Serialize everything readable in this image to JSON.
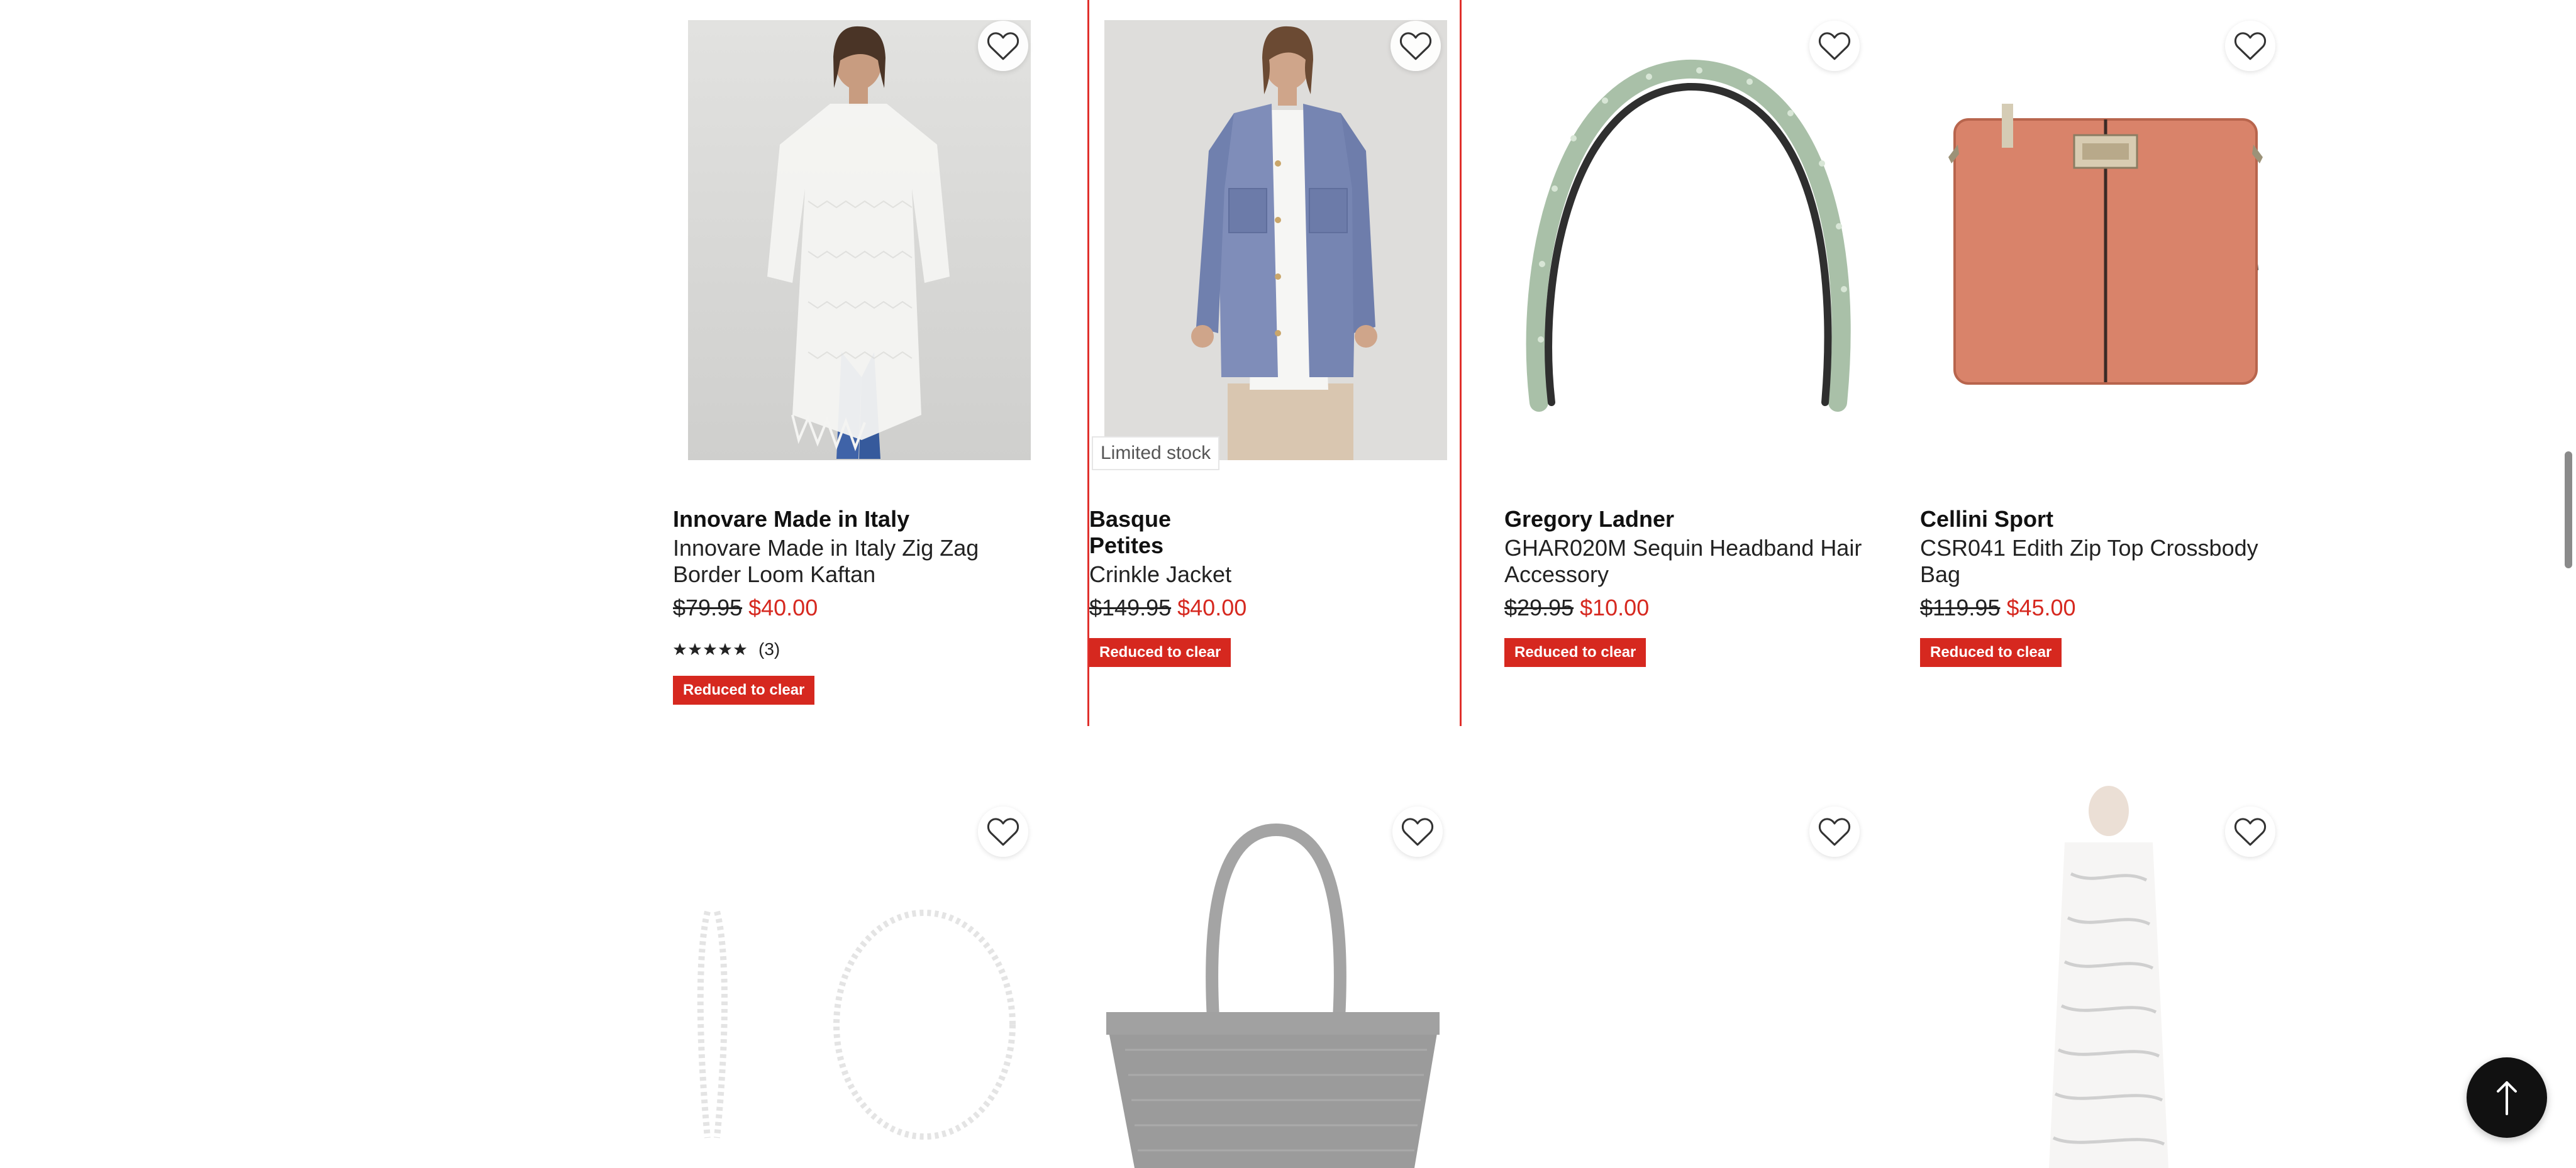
{
  "products": [
    {
      "brand": "Innovare Made in Italy",
      "name": "Innovare Made in Italy Zig Zag Border Loom Kaftan",
      "was_price": "$79.95",
      "now_price": "$40.00",
      "rating_stars": 5,
      "review_count": "(3)",
      "badge": "Reduced to clear",
      "image": "woman-white-kaftan"
    },
    {
      "brand": "Basque Petites",
      "name": "Crinkle Jacket",
      "was_price": "$149.95",
      "now_price": "$40.00",
      "badge": "Reduced to clear",
      "flag": "Limited stock",
      "image": "woman-blue-jacket",
      "selected": true
    },
    {
      "brand": "Gregory Ladner",
      "name": "GHAR020M Sequin Headband Hair Accessory",
      "was_price": "$29.95",
      "now_price": "$10.00",
      "badge": "Reduced to clear",
      "image": "sequin-headband"
    },
    {
      "brand": "Cellini Sport",
      "name": "CSR041 Edith Zip Top Crossbody Bag",
      "was_price": "$119.95",
      "now_price": "$45.00",
      "badge": "Reduced to clear",
      "image": "coral-crossbody-bag"
    }
  ],
  "second_row": [
    {
      "image": "pearl-necklace-bracelet"
    },
    {
      "image": "grey-woven-tote"
    },
    {
      "image": "loading-placeholder"
    },
    {
      "image": "zebra-print-dress"
    }
  ],
  "icons": {
    "favorite": "heart-outline-icon",
    "back_to_top": "arrow-up-icon",
    "star": "star-icon"
  },
  "colors": {
    "sale_red": "#d6281f",
    "selected_border": "#e0302c",
    "back_to_top_bg": "#111111"
  }
}
